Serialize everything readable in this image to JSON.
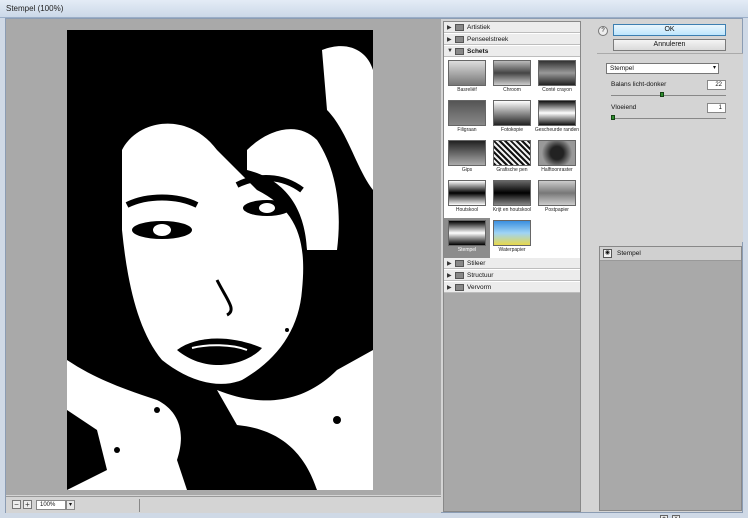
{
  "window": {
    "title": "Stempel (100%)"
  },
  "preview": {
    "zoom_out_label": "−",
    "zoom_in_label": "+",
    "zoom_value": "100%",
    "zoom_dropdown_label": "▾"
  },
  "gallery": {
    "categories_top": [
      {
        "label": "Artistiek",
        "tri": "▶"
      },
      {
        "label": "Penseelstreek",
        "tri": "▶"
      },
      {
        "label": "Schets",
        "tri": "▼"
      }
    ],
    "thumbnails": [
      {
        "label": "Basreliëf"
      },
      {
        "label": "Chroom"
      },
      {
        "label": "Conté crayon"
      },
      {
        "label": "Filigraan"
      },
      {
        "label": "Fotokopie"
      },
      {
        "label": "Gescheurde randen"
      },
      {
        "label": "Gips"
      },
      {
        "label": "Grafische pen"
      },
      {
        "label": "Halftoonraster"
      },
      {
        "label": "Houtskool"
      },
      {
        "label": "Krijt en houtskool"
      },
      {
        "label": "Postpapier"
      },
      {
        "label": "Stempel"
      },
      {
        "label": "Waterpapier"
      }
    ],
    "selected": "Stempel",
    "categories_bottom": [
      {
        "label": "Stileer",
        "tri": "▶"
      },
      {
        "label": "Structuur",
        "tri": "▶"
      },
      {
        "label": "Vervorm",
        "tri": "▶"
      }
    ]
  },
  "right": {
    "help_label": "?",
    "ok_label": "OK",
    "cancel_label": "Annuleren",
    "filter_select": {
      "value": "Stempel",
      "arrow": "▾"
    },
    "params": [
      {
        "label": "Balans licht-donker",
        "value": "22",
        "fraction": 0.44
      },
      {
        "label": "Vloeiend",
        "value": "1",
        "fraction": 0.0
      }
    ],
    "layer": {
      "name": "Stempel",
      "eye": "◉"
    },
    "new_layer_label": "+",
    "delete_layer_label": "×"
  }
}
